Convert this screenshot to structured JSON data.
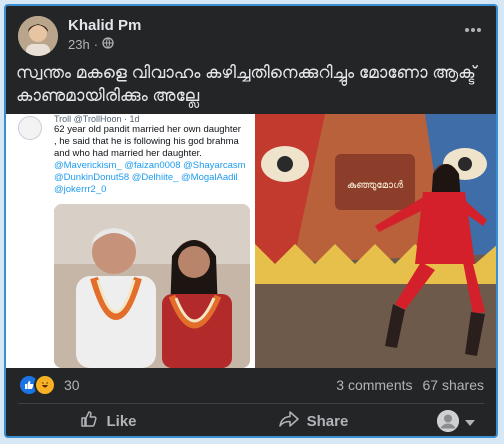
{
  "post": {
    "author": "Khalid Pm",
    "time": "23h",
    "separator": "·",
    "caption": "സ്വന്തം മകളെ വിവാഹം കഴിച്ചതിനെക്കുറിച്ചും മോണോ ആക്ട് കാണുമായിരിക്കും അല്ലേ"
  },
  "tweet": {
    "header": "Troll @TrollHoon · 1d",
    "text": "62 year old pandit married her own daughter , he said that he is following his god brahma and who had married her daughter.",
    "tags": "@Maverickism_ @faizan0008 @Shayarcasm @DunkinDonut58 @Delhiite_ @MogalAadil @jokerrr2_0"
  },
  "stage_sign": "കുഞ്ഞുമോൾ",
  "footer": {
    "reaction_count": "30",
    "comments": "3 comments",
    "shares": "67 shares",
    "like_label": "Like",
    "share_label": "Share"
  },
  "colors": {
    "card_bg": "#242526",
    "accent": "#1b74e4",
    "text_primary": "#e4e6eb",
    "text_secondary": "#b0b3b8",
    "link": "#1d9bf0"
  }
}
